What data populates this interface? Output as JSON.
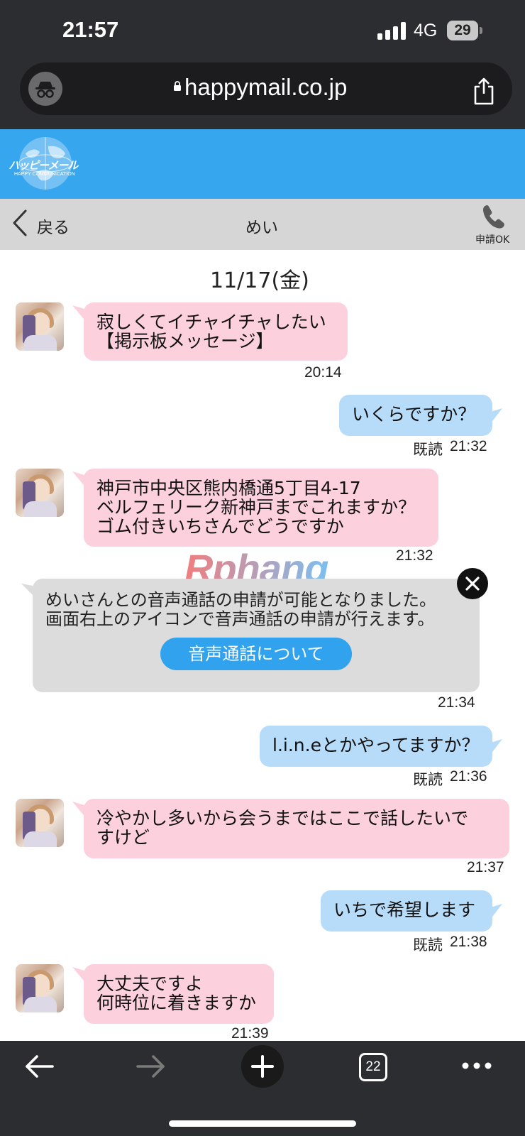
{
  "status_bar": {
    "time": "21:57",
    "network": "4G",
    "battery": "29"
  },
  "browser": {
    "url": "happymail.co.jp",
    "tab_count": "22"
  },
  "brand": {
    "logo_text": "ハッピーメール",
    "logo_subtext": "HAPPY COMMUNICATION"
  },
  "nav": {
    "back_label": "戻る",
    "title": "めい",
    "call_label": "申請OK"
  },
  "chat": {
    "date": "11/17(金)",
    "messages": [
      {
        "side": "left",
        "lines": [
          "寂しくてイチャイチャしたい",
          "【掲示板メッセージ】"
        ],
        "time": "20:14"
      },
      {
        "side": "right",
        "lines": [
          "いくらですか？"
        ],
        "read": "既読",
        "time": "21:32"
      },
      {
        "side": "left",
        "lines": [
          "神戸市中央区熊内橋通5丁目4-17",
          "ベルフェリーク新神戸までこれますか？",
          "ゴム付きいちさんでどうですか"
        ],
        "time": "21:32"
      },
      {
        "side": "right",
        "lines": [
          "l.i.n.eとかやってますか？"
        ],
        "read": "既読",
        "time": "21:36"
      },
      {
        "side": "left",
        "lines": [
          "冷やかし多いから会うまではここで話したいで",
          "すけど"
        ],
        "time": "21:37"
      },
      {
        "side": "right",
        "lines": [
          "いちで希望します"
        ],
        "read": "既読",
        "time": "21:38"
      },
      {
        "side": "left",
        "lines": [
          "大丈夫ですよ",
          "何時位に着きますか"
        ],
        "time": "21:39"
      }
    ],
    "notice": {
      "lines": [
        "めいさんとの音声通話の申請が可能となりました。",
        "画面右上のアイコンで音声通話の申請が行えます。"
      ],
      "button_label": "音声通話について",
      "time": "21:34"
    }
  },
  "watermark": "Rphang",
  "icons": {
    "incognito": "incognito-icon",
    "lock": "lock-icon",
    "share": "share-icon",
    "back": "chevron-left-icon",
    "phone": "phone-icon",
    "close": "close-icon",
    "nav_back": "arrow-left-icon",
    "nav_forward": "arrow-right-icon",
    "new_tab": "plus-icon",
    "tabs": "tabs-icon",
    "more": "more-icon"
  },
  "colors": {
    "header": "#36a6ef",
    "incoming": "#fdd0dd",
    "outgoing": "#b7dcf9",
    "button": "#31a3ee"
  }
}
